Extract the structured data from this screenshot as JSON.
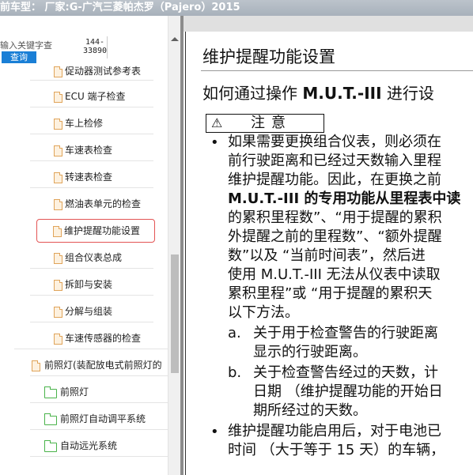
{
  "titlebar": {
    "text": "前车型：  厂家:G-广汽三菱帕杰罗（Pajero）2015"
  },
  "search": {
    "placeholder": "输入关键字查",
    "button_label": "查询",
    "page_ref_top": "144-",
    "page_ref_bottom": "33890"
  },
  "tree": [
    {
      "label": "促动器测试参考表",
      "icon": "doc-icon"
    },
    {
      "label": "ECU 端子检查",
      "icon": "doc-icon"
    },
    {
      "label": "车上检修",
      "icon": "doc-icon"
    },
    {
      "label": "车速表检查",
      "icon": "doc-icon"
    },
    {
      "label": "转速表检查",
      "icon": "doc-icon"
    },
    {
      "label": "燃油表单元的检查",
      "icon": "doc-icon"
    },
    {
      "label": "维护提醒功能设置",
      "icon": "doc-icon",
      "selected": true
    },
    {
      "label": "组合仪表总成",
      "icon": "doc-icon"
    },
    {
      "label": "拆卸与安装",
      "icon": "doc-icon"
    },
    {
      "label": "分解与组装",
      "icon": "doc-icon"
    },
    {
      "label": "车速传感器的检查",
      "icon": "doc-icon"
    },
    {
      "label": "前照灯(装配放电式前照灯的",
      "icon": "doc-icon"
    },
    {
      "label": "前照灯",
      "icon": "folder-icon"
    },
    {
      "label": "前照灯自动调平系统",
      "icon": "folder-icon"
    },
    {
      "label": "自动远光系统",
      "icon": "folder-icon"
    }
  ],
  "document": {
    "title": "维护提醒功能设置",
    "subtitle_prefix": "如何通过操作",
    "subtitle_bold": "M.U.T.-III",
    "subtitle_suffix": "进行设",
    "caution_icon": "⚠",
    "caution_label": "注意",
    "bullet_glyph": "•",
    "lines": [
      "如果需要更换组合仪表，则必须在",
      "前行驶距离和已经过天数输入里程",
      "维护提醒功能。因此，在更换之前",
      "M.U.T.-III 的专用功能从里程表中读",
      "的累积里程数”、“用于提醒的累积",
      "外提醒之前的里程数”、“额外提醒",
      "数”以及 “当前时间表”，然后进",
      "使用 M.U.T.-III 无法从仪表中读取",
      "累积里程”或 “用于提醒的累积天",
      "以下方法。"
    ],
    "sub_a_label": "a.",
    "sub_a_lines": [
      "关于用于检查警告的行驶距离",
      "显示的行驶距离。"
    ],
    "sub_b_label": "b.",
    "sub_b_lines": [
      "关于检查警告经过的天数，计",
      "日期 （维护提醒功能的开始日",
      "期所经过的天数。"
    ],
    "bullet2_lines": [
      "维护提醒功能启用后，对于电池已",
      "时间 （大于等于 15 天）的车辆，"
    ]
  },
  "colors": {
    "selected_border": "#e35454",
    "search_button": "#1a7fd6",
    "doc_icon": "#e0a45a",
    "folder_icon": "#49b34a"
  }
}
